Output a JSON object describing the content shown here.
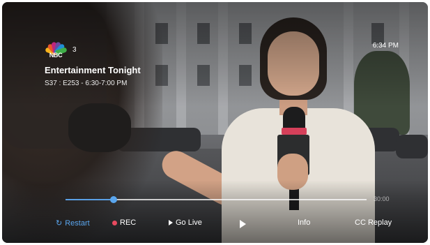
{
  "channel": {
    "logo_text": "NBC",
    "number": "3",
    "logo_icon": "nbc-peacock-icon",
    "feather_colors": [
      "#f7b21c",
      "#e8562a",
      "#c0267c",
      "#6a4aa0",
      "#1f8fd6",
      "#3fae49"
    ]
  },
  "program": {
    "title": "Entertainment Tonight",
    "episode_info": "S37 : E253 -   6:30-7:00 PM"
  },
  "clock": {
    "time": "6:34 PM"
  },
  "playback": {
    "progress_fraction": 0.16,
    "duration_label": "30:00"
  },
  "controls": {
    "restart_icon": "↻",
    "restart_label": "Restart",
    "rec_label": "REC",
    "go_live_label": "Go Live",
    "info_label": "Info",
    "cc_replay_label": "CC Replay"
  },
  "colors": {
    "accent": "#5aa6ee",
    "rec": "#e84a5f"
  }
}
